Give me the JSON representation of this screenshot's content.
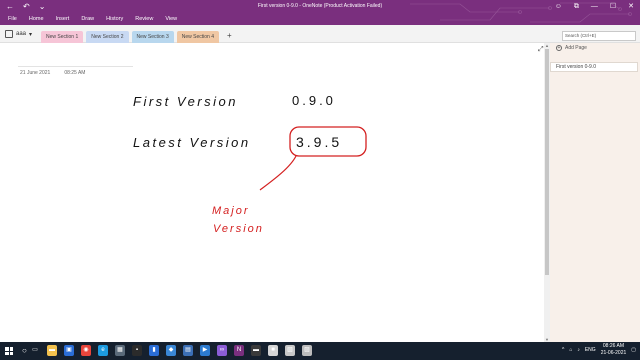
{
  "titlebar": {
    "title": "First version 0-9.0 - OneNote (Product Activation Failed)",
    "qat": {
      "back": "←",
      "undo": "↶",
      "customize": "⌄"
    },
    "winctl": {
      "account": "☺",
      "restore": "⧉",
      "minimize": "—",
      "maximize": "☐",
      "close": "✕"
    }
  },
  "menu": [
    "File",
    "Home",
    "Insert",
    "Draw",
    "History",
    "Review",
    "View"
  ],
  "notebook": {
    "name": "aaa",
    "dropdown": "▾"
  },
  "sections": [
    "New Section 1",
    "New Section 2",
    "New Section 3",
    "New Section 4"
  ],
  "add_section": "+",
  "search": {
    "placeholder": "Search (Ctrl+E)"
  },
  "page": {
    "date": "21 June 2021",
    "time": "08:25 AM",
    "ink": {
      "line1_label": "First Version",
      "line1_value": "0.9.0",
      "line2_label": "Latest Version",
      "line2_value": "3.9.5",
      "annotation_line1": "Major",
      "annotation_line2": "Version"
    }
  },
  "expand_icon": "⤢",
  "scroll": {
    "up": "▲",
    "down": "▼"
  },
  "pagepane": {
    "add_page": "Add Page",
    "add_icon": "+",
    "pages": [
      "First version 0-9.0"
    ]
  },
  "taskbar": {
    "search_icon": "○",
    "apps": [
      {
        "icon": "task-view-icon",
        "glyph": "▭",
        "color": "#15202e"
      },
      {
        "icon": "file-explorer-icon",
        "glyph": "▬",
        "color": "#f2c14e"
      },
      {
        "icon": "store-icon",
        "glyph": "▣",
        "color": "#2a6dd6"
      },
      {
        "icon": "chrome-icon",
        "glyph": "◉",
        "color": "#e8453c"
      },
      {
        "icon": "edge-icon",
        "glyph": "e",
        "color": "#1c9be0"
      },
      {
        "icon": "app-icon",
        "glyph": "▦",
        "color": "#5a6a7a"
      },
      {
        "icon": "terminal-icon",
        "glyph": "▪",
        "color": "#2b2b2b"
      },
      {
        "icon": "explorer2-icon",
        "glyph": "▮",
        "color": "#2a6dd6"
      },
      {
        "icon": "vscode-icon",
        "glyph": "◆",
        "color": "#3a87d6"
      },
      {
        "icon": "photos-icon",
        "glyph": "▤",
        "color": "#3b6fb6"
      },
      {
        "icon": "media-icon",
        "glyph": "▶",
        "color": "#2c7bd0"
      },
      {
        "icon": "vs-icon",
        "glyph": "∞",
        "color": "#8c5dd6"
      },
      {
        "icon": "onenote-icon",
        "glyph": "N",
        "color": "#7a2f7e"
      },
      {
        "icon": "app2-icon",
        "glyph": "▬",
        "color": "#3a3a3a"
      },
      {
        "icon": "app3-icon",
        "glyph": "■",
        "color": "#d6d6d6"
      },
      {
        "icon": "app4-icon",
        "glyph": "▧",
        "color": "#c8c8c8"
      },
      {
        "icon": "app5-icon",
        "glyph": "▨",
        "color": "#bcbcbc"
      }
    ],
    "tray": {
      "chevron": "^",
      "network": "⌂",
      "volume": "♪",
      "language": "ENG",
      "time": "08:26 AM",
      "date": "21-06-2021",
      "notify": "▢"
    }
  }
}
